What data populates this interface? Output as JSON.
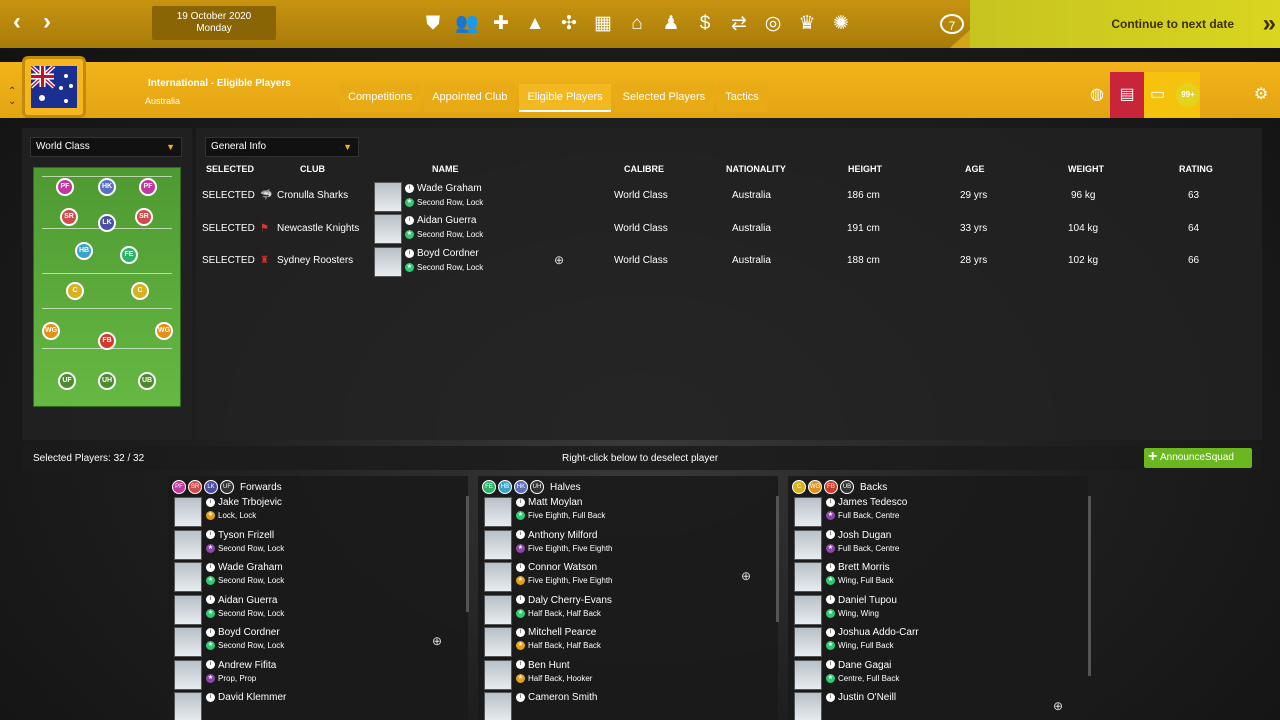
{
  "topbar": {
    "date": "19 October 2020",
    "weekday": "Monday",
    "notifications": "7",
    "continue_label": "Continue to next date",
    "icons": [
      "shield-icon",
      "squad-icon",
      "medical-icon",
      "training-cone-icon",
      "tactics-icon",
      "calendar-icon",
      "home-icon",
      "staff-icon",
      "finance-icon",
      "transfers-icon",
      "scouting-icon",
      "trophy-icon",
      "club-icon"
    ]
  },
  "header": {
    "title": "International - Eligible Players",
    "subtitle": "Australia",
    "tabs": [
      "Competitions",
      "Appointed Club",
      "Eligible Players",
      "Selected Players",
      "Tactics"
    ],
    "active_tab": "Eligible Players",
    "inbox_badge": "99+"
  },
  "filters": {
    "calibre": "World Class",
    "view": "General Info"
  },
  "formation": {
    "positions": [
      "PF",
      "HK",
      "PF",
      "SR",
      "LK",
      "SR",
      "HB",
      "FE",
      "C",
      "C",
      "WG",
      "WG",
      "FB",
      "UF",
      "UH",
      "UB"
    ]
  },
  "table": {
    "columns": [
      "SELECTED",
      "CLUB",
      "NAME",
      "CALIBRE",
      "NATIONALITY",
      "HEIGHT",
      "AGE",
      "WEIGHT",
      "RATING"
    ],
    "rows": [
      {
        "selected": "SELECTED",
        "club": "Cronulla Sharks",
        "name": "Wade Graham",
        "positions": "Second Row, Lock",
        "calibre": "World Class",
        "nationality": "Australia",
        "height": "186 cm",
        "age": "29 yrs",
        "weight": "96 kg",
        "rating": "63"
      },
      {
        "selected": "SELECTED",
        "club": "Newcastle Knights",
        "name": "Aidan Guerra",
        "positions": "Second Row, Lock",
        "calibre": "World Class",
        "nationality": "Australia",
        "height": "191 cm",
        "age": "33 yrs",
        "weight": "104 kg",
        "rating": "64"
      },
      {
        "selected": "SELECTED",
        "club": "Sydney Roosters",
        "name": "Boyd Cordner",
        "positions": "Second Row, Lock",
        "calibre": "World Class",
        "nationality": "Australia",
        "height": "188 cm",
        "age": "28 yrs",
        "weight": "102 kg",
        "rating": "66"
      }
    ]
  },
  "squad": {
    "selected_count": "Selected Players: 32 / 32",
    "hint": "Right-click below to deselect player",
    "announce_label": "AnnounceSquad",
    "groups": [
      {
        "name": "Forwards",
        "codes": [
          "PF",
          "SR",
          "LK",
          "UF"
        ],
        "players": [
          {
            "name": "Jake Trbojevic",
            "pos": "Lock, Lock",
            "tier": "orange"
          },
          {
            "name": "Tyson Frizell",
            "pos": "Second Row, Lock",
            "tier": "purple"
          },
          {
            "name": "Wade Graham",
            "pos": "Second Row, Lock",
            "tier": "green"
          },
          {
            "name": "Aidan Guerra",
            "pos": "Second Row, Lock",
            "tier": "green"
          },
          {
            "name": "Boyd Cordner",
            "pos": "Second Row, Lock",
            "tier": "green"
          },
          {
            "name": "Andrew Fifita",
            "pos": "Prop, Prop",
            "tier": "purple"
          },
          {
            "name": "David Klemmer",
            "pos": "",
            "tier": ""
          }
        ]
      },
      {
        "name": "Halves",
        "codes": [
          "FE",
          "HB",
          "HK",
          "UH"
        ],
        "players": [
          {
            "name": "Matt Moylan",
            "pos": "Five Eighth, Full Back",
            "tier": "green"
          },
          {
            "name": "Anthony Milford",
            "pos": "Five Eighth, Five Eighth",
            "tier": "purple"
          },
          {
            "name": "Connor Watson",
            "pos": "Five Eighth, Five Eighth",
            "tier": "orange"
          },
          {
            "name": "Daly Cherry-Evans",
            "pos": "Half Back, Half Back",
            "tier": "green"
          },
          {
            "name": "Mitchell Pearce",
            "pos": "Half Back, Half Back",
            "tier": "orange"
          },
          {
            "name": "Ben Hunt",
            "pos": "Half Back, Hooker",
            "tier": "orange"
          },
          {
            "name": "Cameron Smith",
            "pos": "",
            "tier": ""
          }
        ]
      },
      {
        "name": "Backs",
        "codes": [
          "C",
          "WG",
          "FB",
          "UB"
        ],
        "players": [
          {
            "name": "James Tedesco",
            "pos": "Full Back, Centre",
            "tier": "purple"
          },
          {
            "name": "Josh Dugan",
            "pos": "Full Back, Centre",
            "tier": "purple"
          },
          {
            "name": "Brett Morris",
            "pos": "Wing, Full Back",
            "tier": "green"
          },
          {
            "name": "Daniel Tupou",
            "pos": "Wing, Wing",
            "tier": "green"
          },
          {
            "name": "Joshua Addo-Carr",
            "pos": "Wing, Full Back",
            "tier": "green"
          },
          {
            "name": "Dane Gagai",
            "pos": "Centre, Full Back",
            "tier": "green"
          },
          {
            "name": "Justin O'Neill",
            "pos": "",
            "tier": ""
          }
        ]
      }
    ]
  }
}
